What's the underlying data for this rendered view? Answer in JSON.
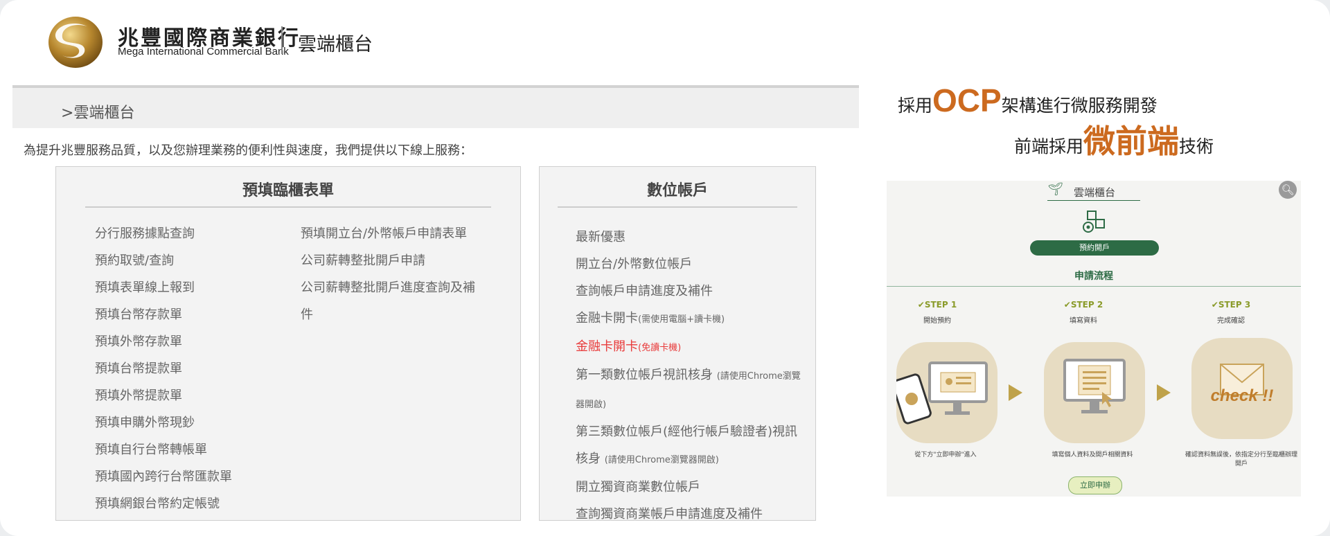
{
  "header": {
    "bank_name_cn": "兆豐國際商業銀行",
    "bank_name_en": "Mega International Commercial Bank",
    "site_name": "雲端櫃台"
  },
  "breadcrumb": {
    "separator": ">",
    "current": "雲端櫃台"
  },
  "intro": "為提升兆豐服務品質，以及您辦理業務的便利性與速度，我們提供以下線上服務：",
  "panel_forms": {
    "title": "預填臨櫃表單",
    "col1": [
      "分行服務據點查詢",
      "預約取號/查詢",
      "預填表單線上報到",
      "預填台幣存款單",
      "預填外幣存款單",
      "預填台幣提款單",
      "預填外幣提款單",
      "預填申購外幣現鈔",
      "預填自行台幣轉帳單",
      "預填國內跨行台幣匯款單",
      "預填網銀台幣約定帳號"
    ],
    "col2": [
      "預填開立台/外幣帳戶申請表單",
      "公司薪轉整批開戶申請",
      "公司薪轉整批開戶進度查詢及補",
      "件"
    ]
  },
  "panel_digital": {
    "title": "數位帳戶",
    "items": [
      {
        "text": "最新優惠",
        "note": ""
      },
      {
        "text": "開立台/外幣數位帳戶",
        "note": ""
      },
      {
        "text": "查詢帳戶申請進度及補件",
        "note": ""
      },
      {
        "text": "金融卡開卡",
        "note": "(需使用電腦+讀卡機)"
      },
      {
        "text": "金融卡開卡",
        "note": "(免讀卡機)"
      },
      {
        "text": "第一類數位帳戶視訊核身",
        "note": "(請使用Chrome瀏覽器開啟)"
      },
      {
        "text": "第三類數位帳戶(經他行帳戶驗證者)視訊核身",
        "note": "(請使用Chrome瀏覽器開啟)"
      },
      {
        "text": "開立獨資商業數位帳戶",
        "note": ""
      },
      {
        "text": "查詢獨資商業帳戶申請進度及補件",
        "note": ""
      }
    ]
  },
  "headline": {
    "line1_a": "採用",
    "line1_highlight": "OCP",
    "line1_b": "架構進行微服務開發",
    "line2_a": "前端採用",
    "line2_highlight": "微前端",
    "line2_b": "技術"
  },
  "mockup": {
    "title": "雲端櫃台",
    "reserve_button": "預約開戶",
    "process_title": "申請流程",
    "steps": [
      {
        "label": "✔STEP 1",
        "sub": "開始預約",
        "desc": "從下方\"立即申辦\"進入"
      },
      {
        "label": "✔STEP 2",
        "sub": "填寫資料",
        "desc": "填寫個人資料及開戶相關資料"
      },
      {
        "label": "✔STEP 3",
        "sub": "完成確認",
        "desc": "確認資料無誤後，依指定分行至臨櫃辦理開戶"
      }
    ],
    "check_text": "check !!",
    "apply_button": "立即申辦"
  },
  "colors": {
    "accent_orange": "#cc6a1f",
    "brand_green": "#2d6b45",
    "alert_red": "#e83a3a",
    "gold": "#bfa24a"
  }
}
